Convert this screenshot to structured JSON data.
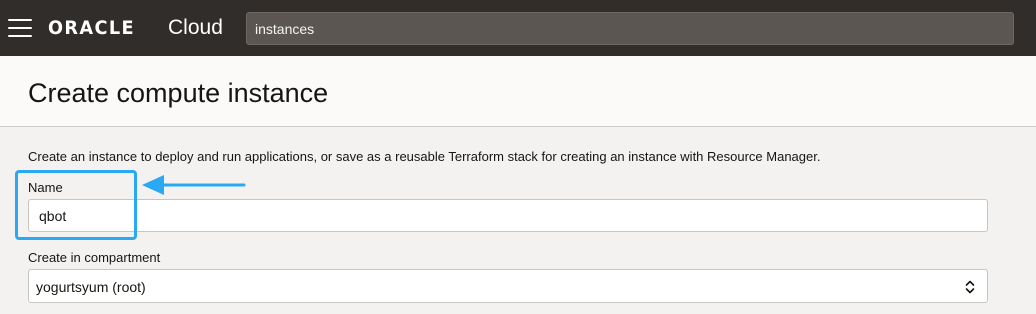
{
  "topbar": {
    "menu_icon": "hamburger-menu-icon",
    "logo_oracle": "ORACLE",
    "logo_cloud": "Cloud",
    "search_value": "instances"
  },
  "page": {
    "title": "Create compute instance",
    "description": "Create an instance to deploy and run applications, or save as a reusable Terraform stack for creating an instance with Resource Manager."
  },
  "form": {
    "name_label": "Name",
    "name_value": "qbot",
    "compartment_label": "Create in compartment",
    "compartment_value": "yogurtsyum (root)",
    "select_icon": "chevron-up-down-icon"
  },
  "annotation": {
    "highlight_color": "#29a9f2",
    "arrow_icon": "arrow-left-icon"
  },
  "colors": {
    "topbar_bg": "#312d2a",
    "page_bg": "#f3f2f0",
    "header_bg": "#fbfaf9"
  }
}
